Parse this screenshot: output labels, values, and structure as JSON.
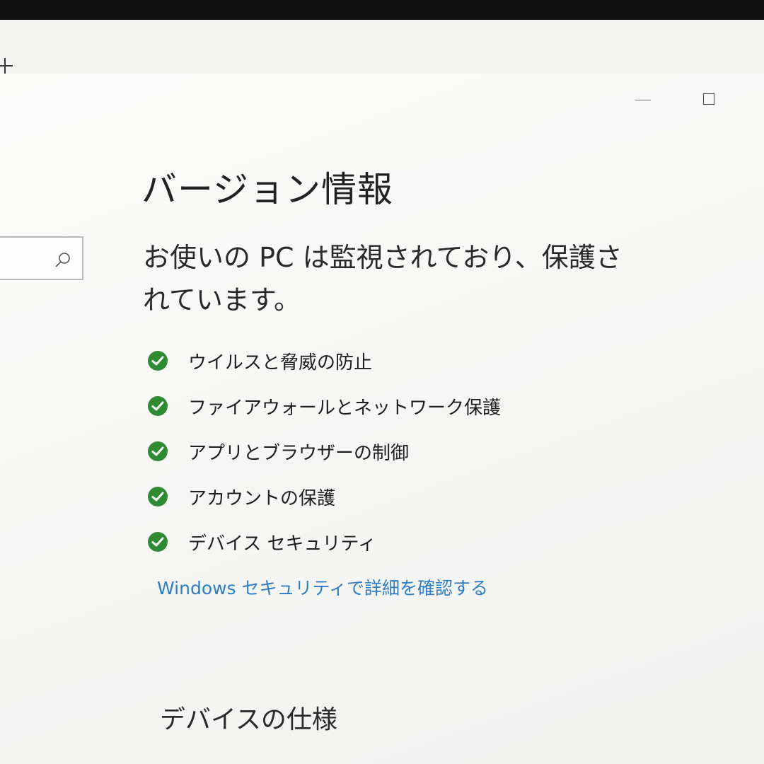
{
  "window": {
    "title": "バージョン情報"
  },
  "search": {
    "placeholder": ""
  },
  "security": {
    "heading": "お使いの PC は監視されており、保護されています。",
    "items": [
      {
        "label": "ウイルスと脅威の防止",
        "icon": "check-circle-icon"
      },
      {
        "label": "ファイアウォールとネットワーク保護",
        "icon": "check-circle-icon"
      },
      {
        "label": "アプリとブラウザーの制御",
        "icon": "check-circle-icon"
      },
      {
        "label": "アカウントの保護",
        "icon": "check-circle-icon"
      },
      {
        "label": "デバイス セキュリティ",
        "icon": "check-circle-icon"
      }
    ],
    "link": "Windows セキュリティで詳細を確認する",
    "check_color": "#2e8b34",
    "link_color": "#2e7dc4"
  },
  "device_specs": {
    "heading": "デバイスの仕様"
  }
}
